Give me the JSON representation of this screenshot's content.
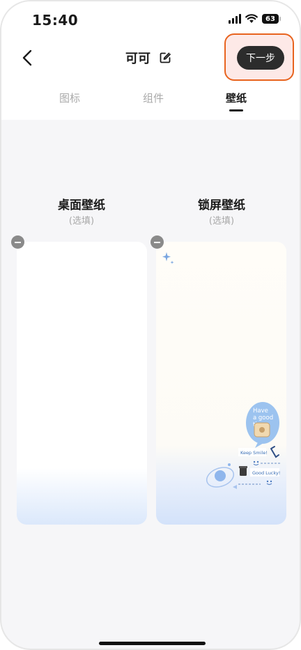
{
  "status_bar": {
    "time": "15:40",
    "battery": "63"
  },
  "header": {
    "title": "可可",
    "next_label": "下一步"
  },
  "tabs": [
    {
      "label": "图标",
      "active": false
    },
    {
      "label": "组件",
      "active": false
    },
    {
      "label": "壁纸",
      "active": true
    }
  ],
  "wallpapers": {
    "desktop": {
      "title": "桌面壁纸",
      "subtitle": "(选填)"
    },
    "lock": {
      "title": "锁屏壁纸",
      "subtitle": "(选填)"
    }
  },
  "lock_decor": {
    "bubble_text": [
      "Have",
      "a good",
      "time"
    ],
    "sticker_1": "Keep Smile!",
    "sticker_2": "Good Lucky!"
  },
  "colors": {
    "accent_highlight": "#e8641f",
    "next_button": "#2c2c2c",
    "bubble_blue": "#9cc3ef"
  }
}
